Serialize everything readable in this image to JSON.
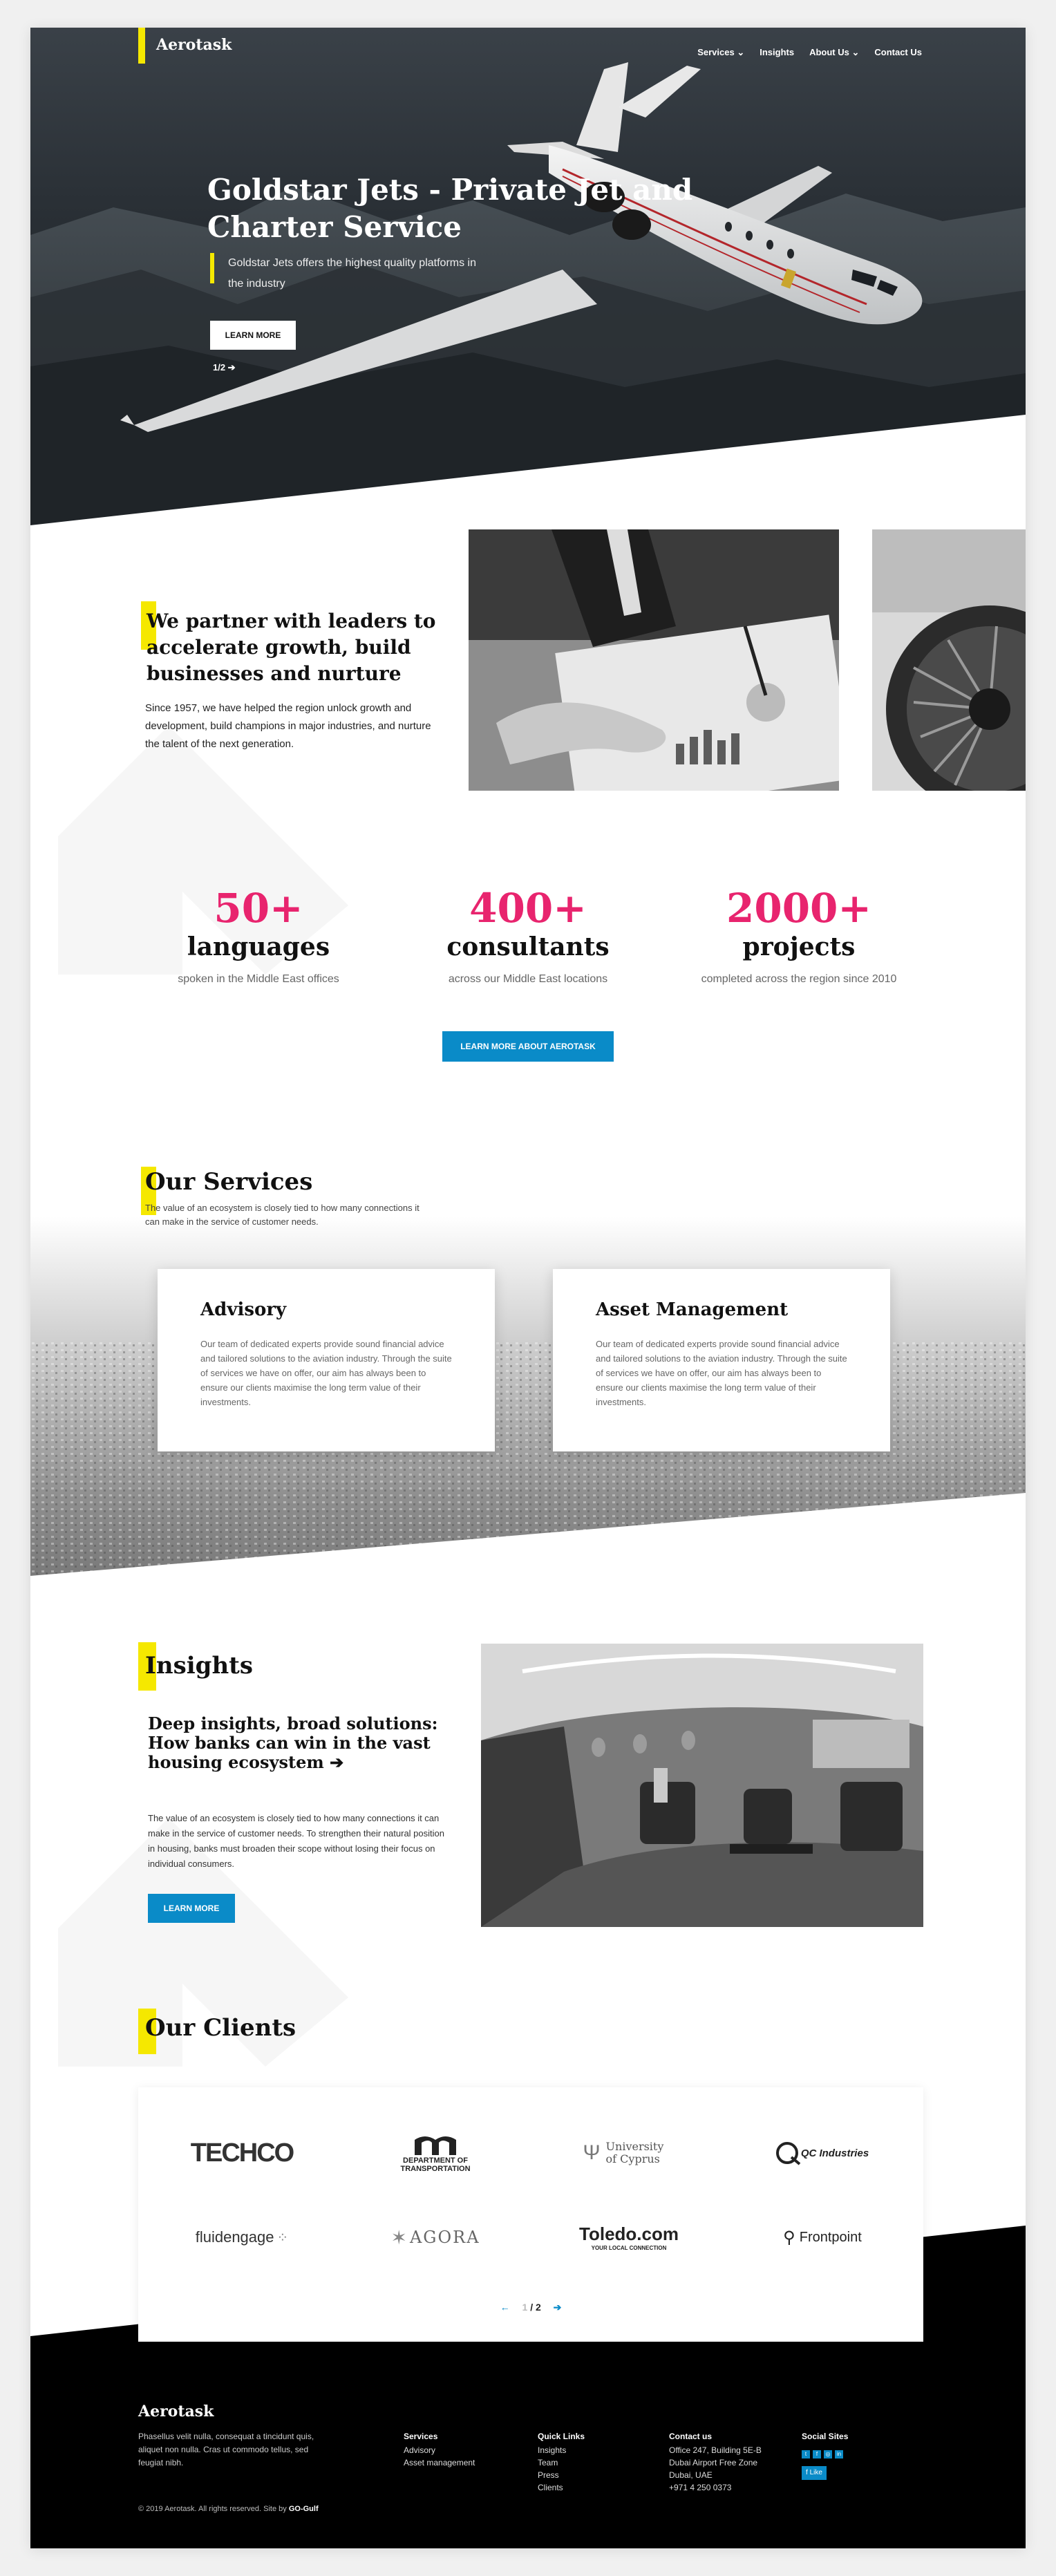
{
  "site": {
    "logo": "Aerotask",
    "nav": [
      {
        "label": "Services",
        "has_dropdown": true
      },
      {
        "label": "Insights",
        "has_dropdown": false
      },
      {
        "label": "About Us",
        "has_dropdown": true
      },
      {
        "label": "Contact Us",
        "has_dropdown": false
      }
    ]
  },
  "hero": {
    "title": "Goldstar Jets - Private Jet and Charter Service",
    "subtitle": "Goldstar Jets offers the highest quality platforms in the industry",
    "button": "LEARN MORE",
    "pager": "1/2 ➔"
  },
  "partner": {
    "title": "We partner with leaders to accelerate growth, build businesses and nurture",
    "text": "Since 1957, we have helped the region unlock growth and development, build champions in major industries, and nurture the talent of the next generation."
  },
  "stats": [
    {
      "number": "50+",
      "label": "languages",
      "description": "spoken in the Middle East offices"
    },
    {
      "number": "400+",
      "label": "consultants",
      "description": "across our Middle East locations"
    },
    {
      "number": "2000+",
      "label": "projects",
      "description": "completed across the region since 2010"
    }
  ],
  "stats_button": "LEARN MORE ABOUT AEROTASK",
  "services": {
    "title": "Our Services",
    "subtitle": "The value of an ecosystem is closely tied to how many connections it can make in the service of customer needs.",
    "cards": [
      {
        "title": "Advisory",
        "text": "Our team of dedicated experts provide sound financial advice and tailored solutions to the aviation industry. Through the suite of services we have on offer, our aim has always been to ensure our clients maximise the long term value of their investments."
      },
      {
        "title": "Asset Management",
        "text": "Our team of dedicated experts provide sound financial advice and tailored solutions to the aviation industry. Through the suite of services we have on offer, our aim has always been to ensure our clients maximise the long term value of their investments."
      }
    ]
  },
  "insights": {
    "title": "Insights",
    "headline": "Deep insights, broad solutions: How banks can win in the vast housing ecosystem ➔",
    "text": "The value of an ecosystem is closely tied to how many connections it can make in the service of customer needs. To strengthen their natural position in housing, banks must broaden their scope without losing their focus on individual consumers.",
    "button": "LEARN MORE"
  },
  "clients": {
    "title": "Our Clients",
    "logos": [
      {
        "name": "TECHCO",
        "style": "techco"
      },
      {
        "name": "DEPARTMENT OF TRANSPORTATION",
        "style": "dot"
      },
      {
        "name": "University of Cyprus",
        "style": "cyprus"
      },
      {
        "name": "QC Industries",
        "style": "qc"
      },
      {
        "name": "fluidengage",
        "style": "fluid"
      },
      {
        "name": "AGORA",
        "style": "agora"
      },
      {
        "name": "Toledo.com",
        "sub": "YOUR LOCAL CONNECTION",
        "style": "toledo"
      },
      {
        "name": "Frontpoint",
        "style": "frontpoint"
      }
    ],
    "pager": "/ 2",
    "prev_arrow": "←",
    "next_arrow": "➔"
  },
  "footer": {
    "logo": "Aerotask",
    "about": "Phasellus velit nulla, consequat a tincidunt quis, aliquet non nulla. Cras ut commodo tellus, sed feugiat nibh.",
    "columns": [
      {
        "heading": "Services",
        "items": [
          "Advisory",
          "Asset management"
        ]
      },
      {
        "heading": "Quick Links",
        "items": [
          "Insights",
          "Team",
          "Press",
          "Clients"
        ]
      },
      {
        "heading": "Contact us",
        "items": [
          "Office 247, Building 5E-B",
          "Dubai Airport Free Zone",
          "Dubai, UAE",
          "+971 4 250 0373"
        ]
      },
      {
        "heading": "Social Sites",
        "items": []
      }
    ],
    "social_icons": [
      "twitter-icon",
      "facebook-icon",
      "instagram-icon",
      "linkedin-icon"
    ],
    "like_button": "Like",
    "copyright": "© 2019 Aerotask. All rights reserved. Site by",
    "credit": "GO-Gulf"
  },
  "colors": {
    "accent_yellow": "#f5e800",
    "accent_pink": "#e8246e",
    "accent_blue": "#0a8bc8",
    "footer_bg": "#000000"
  }
}
